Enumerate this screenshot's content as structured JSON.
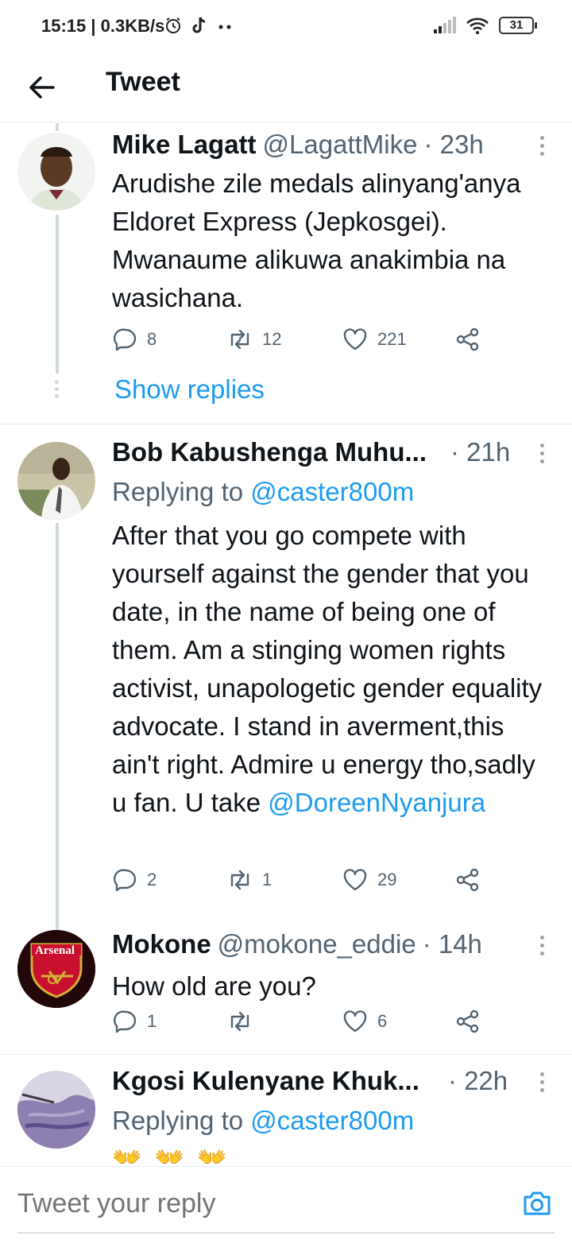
{
  "status_bar": {
    "time": "15:15",
    "network_speed": "| 0.3KB/s",
    "battery": "31",
    "icons": [
      "alarm-icon",
      "tiktok-icon",
      "dots-icon",
      "signal-icon",
      "wifi-icon",
      "battery-icon"
    ]
  },
  "header": {
    "title": "Tweet",
    "back_icon": "arrow-left-icon"
  },
  "tweets": [
    {
      "name": "Mike Lagatt",
      "handle": "@LagattMike",
      "time": "· 23h",
      "replying_prefix": "",
      "replying_to": "",
      "text": "Arudishe zile medals alinyang'anya Eldoret Express (Jepkosgei). Mwanaume alikuwa anakimbia na wasichana.",
      "mention": "",
      "replies": "8",
      "retweets": "12",
      "likes": "221",
      "show_replies": "Show replies"
    },
    {
      "name": "Bob Kabushenga Muhu...",
      "handle": "",
      "time": "· 21h",
      "replying_prefix": "Replying to ",
      "replying_to": "@caster800m",
      "text": "After that you go compete with yourself against the gender that you date, in the name of being one of them. Am a stinging women rights activist, unapologetic gender equality advocate. I stand in averment,this ain't right. Admire u energy tho,sadly u fan. U take",
      "mention": "@DoreenNyanjura",
      "replies": "2",
      "retweets": "1",
      "likes": "29"
    },
    {
      "name": "Mokone",
      "handle": "@mokone_eddie",
      "time": "· 14h",
      "text": "How old are you?",
      "avatar_text": "Arsenal",
      "replies": "1",
      "retweets": "",
      "likes": "6"
    },
    {
      "name": "Kgosi Kulenyane Khuk...",
      "handle": "",
      "time": "· 22h",
      "replying_prefix": "Replying to ",
      "replying_to": "@caster800m",
      "emoji": "👐 👐 👐"
    }
  ],
  "reply_bar": {
    "placeholder": "Tweet your reply",
    "camera_icon": "camera-icon"
  },
  "colors": {
    "accent": "#1d9bf0",
    "text": "#0f1419",
    "secondary": "#536471",
    "divider": "#e6ecf0"
  }
}
